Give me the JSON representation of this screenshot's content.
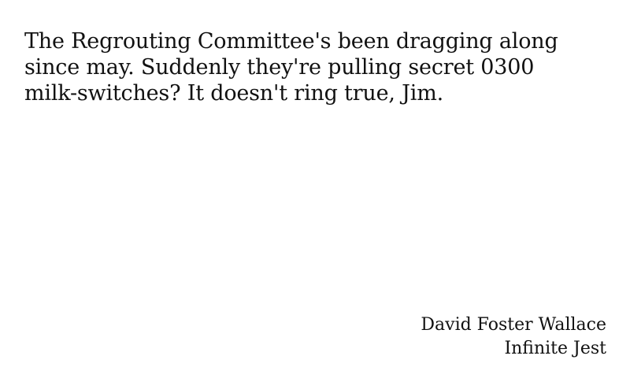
{
  "quote": {
    "lines": [
      "The Regrouting Committee's been dragging along",
      "since may. Suddenly they're pulling secret 0300",
      "milk-switches? It doesn't ring true, Jim."
    ]
  },
  "attribution": {
    "author": "David Foster Wallace",
    "work": "Infinite Jest"
  }
}
